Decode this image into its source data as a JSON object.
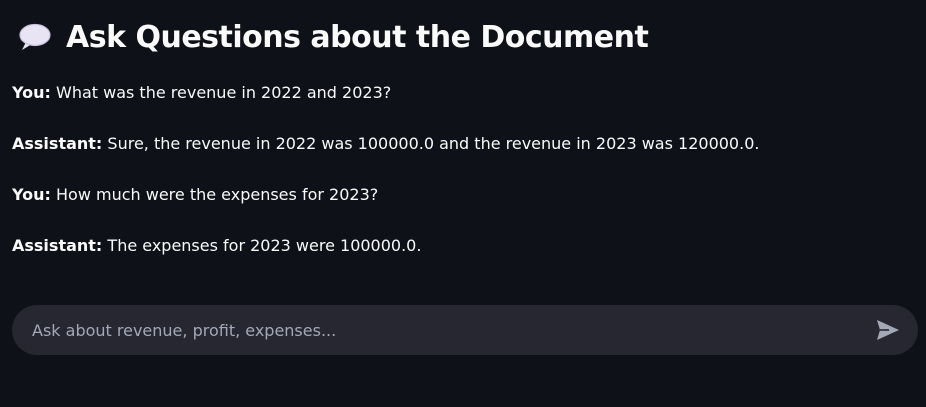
{
  "header": {
    "icon": "speech-balloon-icon",
    "title": "Ask Questions about the Document"
  },
  "messages": [
    {
      "role": "You:",
      "text": " What was the revenue in 2022 and 2023?"
    },
    {
      "role": "Assistant:",
      "text": " Sure, the revenue in 2022 was 100000.0 and the revenue in 2023 was 120000.0."
    },
    {
      "role": "You:",
      "text": " How much were the expenses for 2023?"
    },
    {
      "role": "Assistant:",
      "text": " The expenses for 2023 were 100000.0."
    }
  ],
  "chat_input": {
    "placeholder": "Ask about revenue, profit, expenses...",
    "value": "",
    "send_icon": "send-icon"
  },
  "colors": {
    "background": "#0e1117",
    "text": "#fafafa",
    "input_background": "#262730",
    "placeholder": "#a3a8b8",
    "send_icon": "#a3a8b8"
  }
}
